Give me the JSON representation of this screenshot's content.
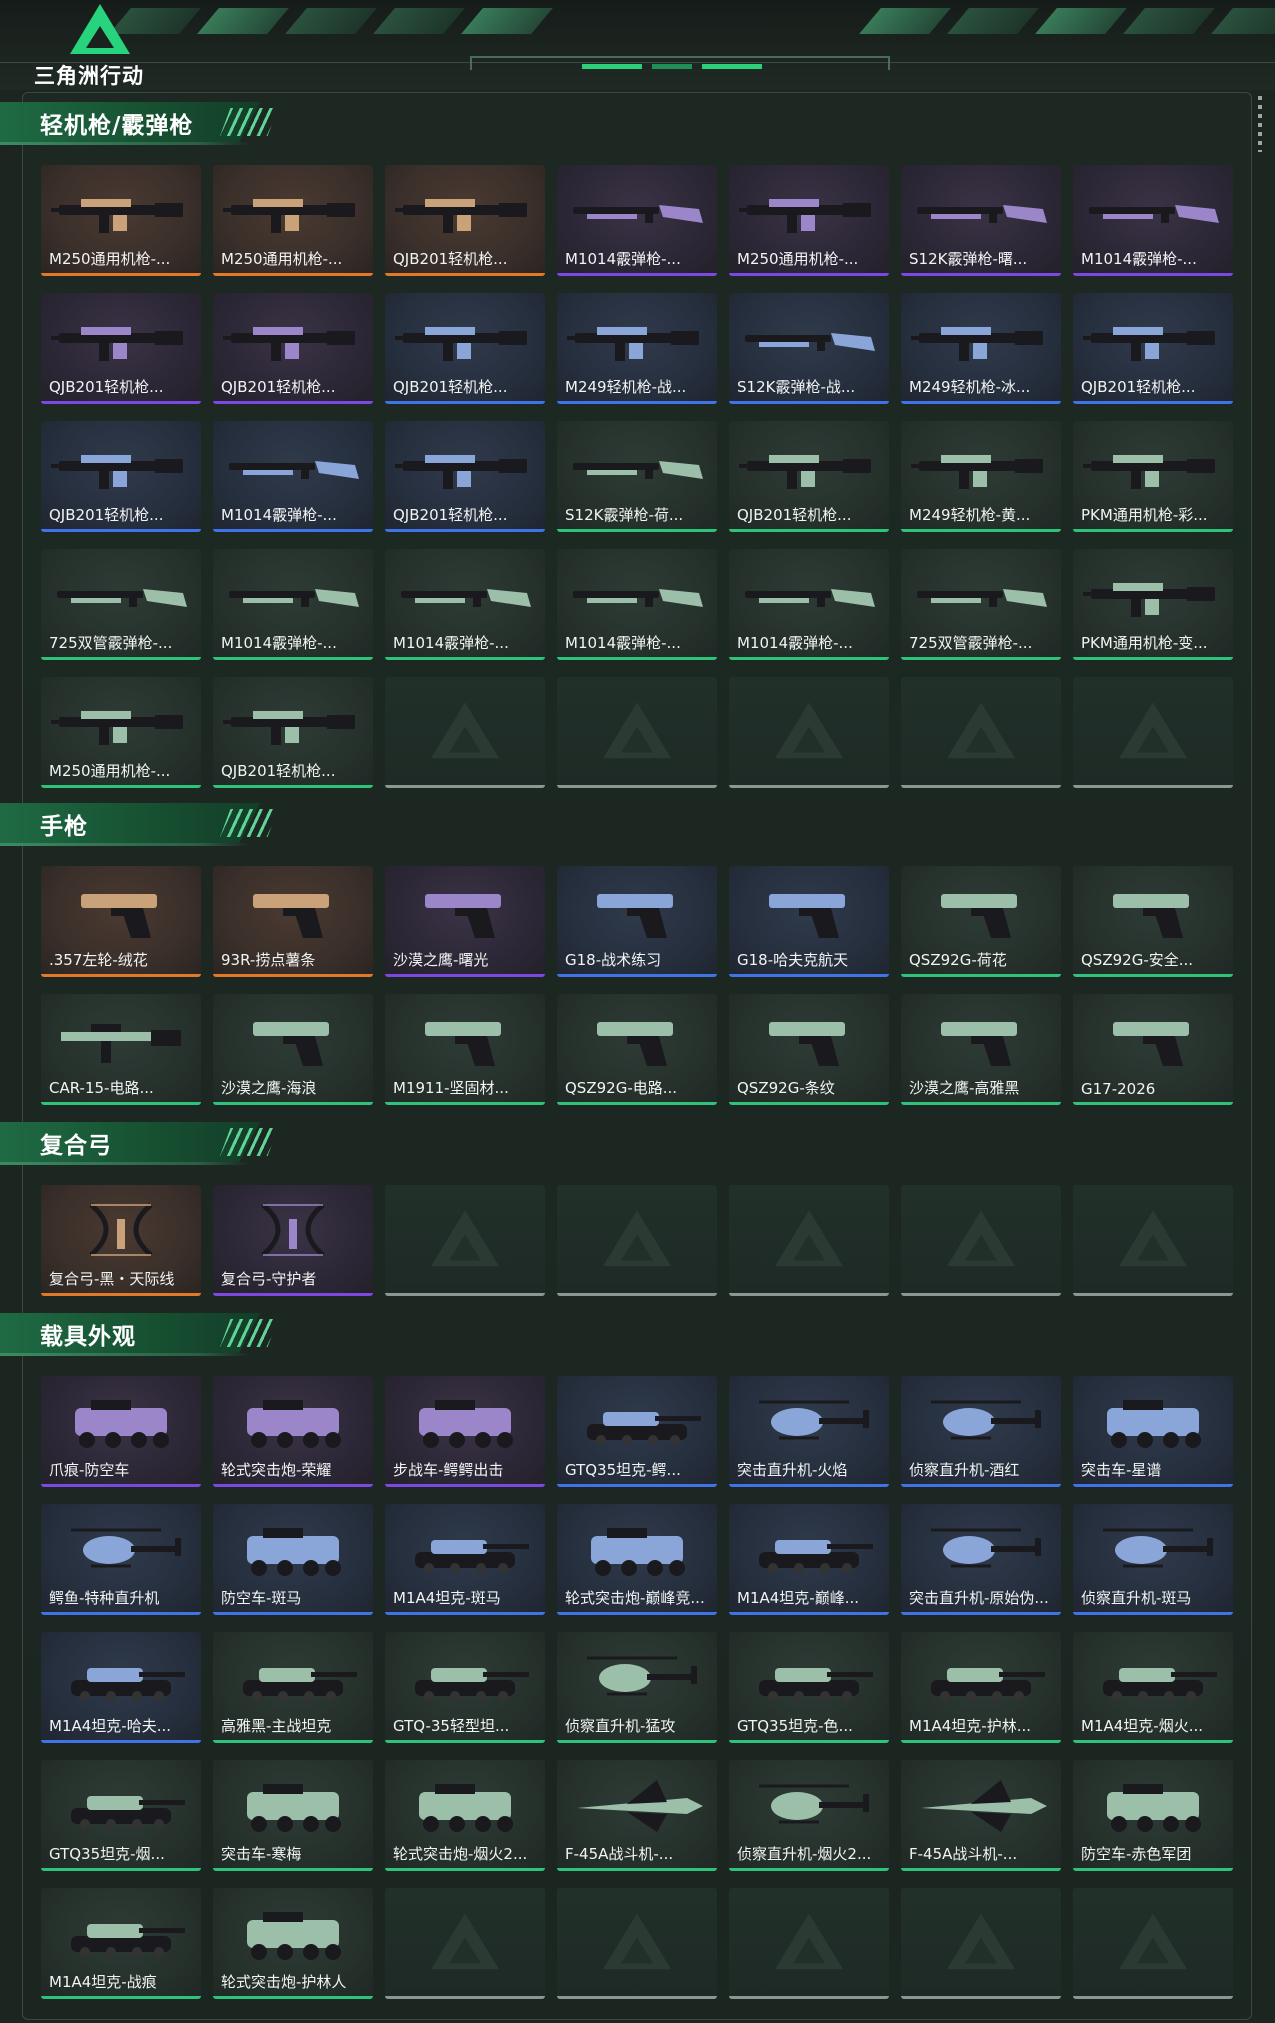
{
  "header": {
    "logo_text": "三角洲行动"
  },
  "colors": {
    "accent_green": "#27d37d",
    "rarity_purple": "#7b49e0",
    "rarity_orange": "#e07a2a",
    "rarity_blue": "#3f73e6",
    "rarity_green": "#2fc27a"
  },
  "sections": [
    {
      "title": "轻机枪/霰弹枪",
      "items": [
        {
          "label": "M250通用机枪-...",
          "rarity": "orange",
          "icon": "machine-gun"
        },
        {
          "label": "M250通用机枪-...",
          "rarity": "orange",
          "icon": "machine-gun"
        },
        {
          "label": "QJB201轻机枪...",
          "rarity": "orange",
          "icon": "machine-gun"
        },
        {
          "label": "M1014霰弹枪-...",
          "rarity": "purple",
          "icon": "shotgun"
        },
        {
          "label": "M250通用机枪-...",
          "rarity": "purple",
          "icon": "machine-gun"
        },
        {
          "label": "S12K霰弹枪-曙...",
          "rarity": "purple",
          "icon": "shotgun"
        },
        {
          "label": "M1014霰弹枪-...",
          "rarity": "purple",
          "icon": "shotgun"
        },
        {
          "label": "QJB201轻机枪...",
          "rarity": "purple",
          "icon": "machine-gun"
        },
        {
          "label": "QJB201轻机枪...",
          "rarity": "purple",
          "icon": "machine-gun"
        },
        {
          "label": "QJB201轻机枪...",
          "rarity": "blue",
          "icon": "machine-gun"
        },
        {
          "label": "M249轻机枪-战...",
          "rarity": "blue",
          "icon": "machine-gun"
        },
        {
          "label": "S12K霰弹枪-战...",
          "rarity": "blue",
          "icon": "shotgun"
        },
        {
          "label": "M249轻机枪-冰...",
          "rarity": "blue",
          "icon": "machine-gun"
        },
        {
          "label": "QJB201轻机枪...",
          "rarity": "blue",
          "icon": "machine-gun"
        },
        {
          "label": "QJB201轻机枪...",
          "rarity": "blue",
          "icon": "machine-gun"
        },
        {
          "label": "M1014霰弹枪-...",
          "rarity": "blue",
          "icon": "shotgun"
        },
        {
          "label": "QJB201轻机枪...",
          "rarity": "blue",
          "icon": "machine-gun"
        },
        {
          "label": "S12K霰弹枪-荷...",
          "rarity": "green",
          "icon": "shotgun"
        },
        {
          "label": "QJB201轻机枪...",
          "rarity": "green",
          "icon": "machine-gun"
        },
        {
          "label": "M249轻机枪-黄...",
          "rarity": "green",
          "icon": "machine-gun"
        },
        {
          "label": "PKM通用机枪-彩...",
          "rarity": "green",
          "icon": "machine-gun"
        },
        {
          "label": "725双管霰弹枪-...",
          "rarity": "green",
          "icon": "shotgun"
        },
        {
          "label": "M1014霰弹枪-...",
          "rarity": "green",
          "icon": "shotgun"
        },
        {
          "label": "M1014霰弹枪-...",
          "rarity": "green",
          "icon": "shotgun"
        },
        {
          "label": "M1014霰弹枪-...",
          "rarity": "green",
          "icon": "shotgun"
        },
        {
          "label": "M1014霰弹枪-...",
          "rarity": "green",
          "icon": "shotgun"
        },
        {
          "label": "725双管霰弹枪-...",
          "rarity": "green",
          "icon": "shotgun"
        },
        {
          "label": "PKM通用机枪-变...",
          "rarity": "green",
          "icon": "machine-gun"
        },
        {
          "label": "M250通用机枪-...",
          "rarity": "green",
          "icon": "machine-gun"
        },
        {
          "label": "QJB201轻机枪...",
          "rarity": "green",
          "icon": "machine-gun"
        },
        {
          "label": "",
          "rarity": "empty"
        },
        {
          "label": "",
          "rarity": "empty"
        },
        {
          "label": "",
          "rarity": "empty"
        },
        {
          "label": "",
          "rarity": "empty"
        },
        {
          "label": "",
          "rarity": "empty"
        }
      ]
    },
    {
      "title": "手枪",
      "items": [
        {
          "label": ".357左轮-绒花",
          "rarity": "orange",
          "icon": "pistol"
        },
        {
          "label": "93R-捞点薯条",
          "rarity": "orange",
          "icon": "pistol"
        },
        {
          "label": "沙漠之鹰-曙光",
          "rarity": "purple",
          "icon": "pistol"
        },
        {
          "label": "G18-战术练习",
          "rarity": "blue",
          "icon": "pistol"
        },
        {
          "label": "G18-哈夫克航天",
          "rarity": "blue",
          "icon": "pistol"
        },
        {
          "label": "QSZ92G-荷花",
          "rarity": "green",
          "icon": "pistol"
        },
        {
          "label": "QSZ92G-安全...",
          "rarity": "green",
          "icon": "pistol"
        },
        {
          "label": "CAR-15-电路...",
          "rarity": "green",
          "icon": "rifle"
        },
        {
          "label": "沙漠之鹰-海浪",
          "rarity": "green",
          "icon": "pistol"
        },
        {
          "label": "M1911-坚固材...",
          "rarity": "green",
          "icon": "pistol"
        },
        {
          "label": "QSZ92G-电路...",
          "rarity": "green",
          "icon": "pistol"
        },
        {
          "label": "QSZ92G-条纹",
          "rarity": "green",
          "icon": "pistol"
        },
        {
          "label": "沙漠之鹰-高雅黑",
          "rarity": "green",
          "icon": "pistol"
        },
        {
          "label": "G17-2026",
          "rarity": "green",
          "icon": "pistol"
        }
      ]
    },
    {
      "title": "复合弓",
      "items": [
        {
          "label": "复合弓-黑・天际线",
          "rarity": "orange",
          "icon": "bow"
        },
        {
          "label": "复合弓-守护者",
          "rarity": "purple",
          "icon": "bow"
        },
        {
          "label": "",
          "rarity": "empty"
        },
        {
          "label": "",
          "rarity": "empty"
        },
        {
          "label": "",
          "rarity": "empty"
        },
        {
          "label": "",
          "rarity": "empty"
        },
        {
          "label": "",
          "rarity": "empty"
        }
      ]
    },
    {
      "title": "载具外观",
      "items": [
        {
          "label": "爪痕-防空车",
          "rarity": "purple",
          "icon": "apc"
        },
        {
          "label": "轮式突击炮-荣耀",
          "rarity": "purple",
          "icon": "apc"
        },
        {
          "label": "步战车-鳄鳄出击",
          "rarity": "purple",
          "icon": "apc"
        },
        {
          "label": "GTQ35坦克-鳄...",
          "rarity": "blue",
          "icon": "tank"
        },
        {
          "label": "突击直升机-火焰",
          "rarity": "blue",
          "icon": "helicopter"
        },
        {
          "label": "侦察直升机-酒红",
          "rarity": "blue",
          "icon": "helicopter"
        },
        {
          "label": "突击车-星谱",
          "rarity": "blue",
          "icon": "apc"
        },
        {
          "label": "鳄鱼-特种直升机",
          "rarity": "blue",
          "icon": "helicopter"
        },
        {
          "label": "防空车-斑马",
          "rarity": "blue",
          "icon": "apc"
        },
        {
          "label": "M1A4坦克-斑马",
          "rarity": "blue",
          "icon": "tank"
        },
        {
          "label": "轮式突击炮-巅峰竞...",
          "rarity": "blue",
          "icon": "apc"
        },
        {
          "label": "M1A4坦克-巅峰...",
          "rarity": "blue",
          "icon": "tank"
        },
        {
          "label": "突击直升机-原始伪...",
          "rarity": "blue",
          "icon": "helicopter"
        },
        {
          "label": "侦察直升机-斑马",
          "rarity": "blue",
          "icon": "helicopter"
        },
        {
          "label": "M1A4坦克-哈夫...",
          "rarity": "blue",
          "icon": "tank"
        },
        {
          "label": "高雅黑-主战坦克",
          "rarity": "green",
          "icon": "tank"
        },
        {
          "label": "GTQ-35轻型坦...",
          "rarity": "green",
          "icon": "tank"
        },
        {
          "label": "侦察直升机-猛攻",
          "rarity": "green",
          "icon": "helicopter"
        },
        {
          "label": "GTQ35坦克-色...",
          "rarity": "green",
          "icon": "tank"
        },
        {
          "label": "M1A4坦克-护林...",
          "rarity": "green",
          "icon": "tank"
        },
        {
          "label": "M1A4坦克-烟火...",
          "rarity": "green",
          "icon": "tank"
        },
        {
          "label": "GTQ35坦克-烟...",
          "rarity": "green",
          "icon": "tank"
        },
        {
          "label": "突击车-寒梅",
          "rarity": "green",
          "icon": "apc"
        },
        {
          "label": "轮式突击炮-烟火2...",
          "rarity": "green",
          "icon": "apc"
        },
        {
          "label": "F-45A战斗机-...",
          "rarity": "green",
          "icon": "jet"
        },
        {
          "label": "侦察直升机-烟火2...",
          "rarity": "green",
          "icon": "helicopter"
        },
        {
          "label": "F-45A战斗机-...",
          "rarity": "green",
          "icon": "jet"
        },
        {
          "label": "防空车-赤色军团",
          "rarity": "green",
          "icon": "apc"
        },
        {
          "label": "M1A4坦克-战痕",
          "rarity": "green",
          "icon": "tank"
        },
        {
          "label": "轮式突击炮-护林人",
          "rarity": "green",
          "icon": "apc"
        },
        {
          "label": "",
          "rarity": "empty"
        },
        {
          "label": "",
          "rarity": "empty"
        },
        {
          "label": "",
          "rarity": "empty"
        },
        {
          "label": "",
          "rarity": "empty"
        },
        {
          "label": "",
          "rarity": "empty"
        }
      ]
    }
  ]
}
